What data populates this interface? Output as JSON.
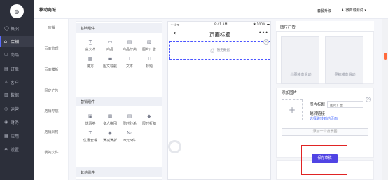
{
  "header": {
    "breadcrumb": "移动商城",
    "upgrade_label": "套餐升级",
    "user_name": "微商城测试"
  },
  "logo_glyph": "◎",
  "sidebar": {
    "items": [
      {
        "label": "概况",
        "icon": "circle-icon",
        "glyph": "◯"
      },
      {
        "label": "店铺",
        "icon": "store-icon",
        "glyph": "⌂"
      },
      {
        "label": "商品",
        "icon": "box-icon",
        "glyph": "▢"
      },
      {
        "label": "订单",
        "icon": "order-icon",
        "glyph": "▤"
      },
      {
        "label": "客户",
        "icon": "user-icon",
        "glyph": "♙"
      },
      {
        "label": "数据",
        "icon": "chart-icon",
        "glyph": "▥"
      },
      {
        "label": "运营",
        "icon": "target-icon",
        "glyph": "◎"
      },
      {
        "label": "财务",
        "icon": "coin-icon",
        "glyph": "◉"
      },
      {
        "label": "应用",
        "icon": "apps-icon",
        "glyph": "▦"
      },
      {
        "label": "设置",
        "icon": "gear-icon",
        "glyph": "✲"
      }
    ]
  },
  "subnav": {
    "items": [
      "店铺",
      "页面管理",
      "页面模板",
      "固定广告",
      "店铺导航",
      "店铺风格",
      "我的文件"
    ]
  },
  "components": {
    "basic_title": "基础组件",
    "basic": [
      {
        "label": "富文本",
        "icon": "richtext-icon",
        "glyph": "T̲"
      },
      {
        "label": "商品",
        "icon": "goods-icon",
        "glyph": "▭"
      },
      {
        "label": "商品分类",
        "icon": "category-icon",
        "glyph": "▤"
      },
      {
        "label": "图片广告",
        "icon": "image-ad-icon",
        "glyph": "▨"
      },
      {
        "label": "魔方",
        "icon": "cube-icon",
        "glyph": "▦"
      },
      {
        "label": "图文导航",
        "icon": "nav-icon",
        "glyph": "▬"
      },
      {
        "label": "文本",
        "icon": "text-icon",
        "glyph": "T"
      },
      {
        "label": "标题",
        "icon": "title-icon",
        "glyph": "Tı"
      }
    ],
    "marketing_title": "营销组件",
    "marketing": [
      {
        "label": "优惠券",
        "icon": "coupon-icon",
        "glyph": "▣"
      },
      {
        "label": "多人拼团",
        "icon": "group-icon",
        "glyph": "▩"
      },
      {
        "label": "限时秒杀",
        "icon": "flash-icon",
        "glyph": "▤"
      },
      {
        "label": "限时折扣",
        "icon": "tag-icon",
        "glyph": "◆"
      },
      {
        "label": "优惠套餐",
        "icon": "package-icon",
        "glyph": "T"
      },
      {
        "label": "满减满折",
        "icon": "discount-icon",
        "glyph": "◆"
      },
      {
        "label": "N元N件",
        "icon": "n-items-icon",
        "glyph": "Nₙ"
      }
    ],
    "other_title": "其他组件"
  },
  "phone": {
    "carrier": "••ıl ᯤ",
    "time": "9:41 AM",
    "battery": "✱ 100% ▬",
    "title": "页面标题",
    "back_glyph": "‹",
    "more_glyph": "•••",
    "placeholder": "暂无数据",
    "placeholder_glyph": "⎙"
  },
  "panel": {
    "title": "图片广告",
    "templates": [
      "小图横向滑动",
      "导航横向滑动"
    ],
    "add_image_title": "添加图片",
    "image_title_label": "图片标题",
    "image_title_value": "图片广告",
    "jump_label": "跳转链接",
    "jump_link": "选择跳转到的页面",
    "add_button": "添加一个背景图",
    "save_button": "保存草稿"
  }
}
